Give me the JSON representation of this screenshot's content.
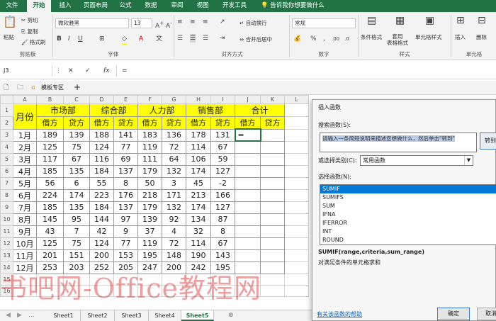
{
  "ribbon_tabs": [
    {
      "label": "文件",
      "active": false
    },
    {
      "label": "开始",
      "active": true
    },
    {
      "label": "插入",
      "active": false
    },
    {
      "label": "页面布局",
      "active": false
    },
    {
      "label": "公式",
      "active": false
    },
    {
      "label": "数据",
      "active": false
    },
    {
      "label": "审阅",
      "active": false
    },
    {
      "label": "视图",
      "active": false
    },
    {
      "label": "开发工具",
      "active": false
    }
  ],
  "tell_me": "告诉我你想要做什么",
  "ribbon": {
    "paste": "粘贴",
    "cut": "剪切",
    "copy": "复制",
    "format_painter": "格式刷",
    "font_name": "微软雅黑",
    "font_size": "13",
    "wrap_text": "自动换行",
    "merge_center": "合并后居中",
    "number_format": "常规",
    "conditional_format": "条件格式",
    "table_format": "套用\n表格格式",
    "cell_styles": "单元格样式",
    "insert": "插入",
    "delete": "删除",
    "groups": {
      "clipboard": "剪贴板",
      "font": "字体",
      "alignment": "对齐方式",
      "number": "数字",
      "styles": "样式",
      "cells": "单元格"
    }
  },
  "formula_bar": {
    "name_box": "J3",
    "content": "="
  },
  "quick_bar": {
    "template_tab": "模板专区",
    "add": "+"
  },
  "sheet": {
    "columns": [
      "A",
      "B",
      "C",
      "D",
      "E",
      "F",
      "G",
      "H",
      "I",
      "J",
      "K",
      "L"
    ],
    "row_numbers": [
      "1",
      "2",
      "3",
      "4",
      "5",
      "6",
      "7",
      "8",
      "9",
      "10",
      "11",
      "12",
      "13",
      "14",
      "15",
      "16"
    ],
    "month_header": "月份",
    "dept_headers": [
      "市场部",
      "综合部",
      "人力部",
      "销售部",
      "合计"
    ],
    "sub_headers": [
      "借方",
      "贷方",
      "借方",
      "贷方",
      "借方",
      "贷方",
      "借方",
      "贷方",
      "借方",
      "贷方"
    ],
    "rows": [
      {
        "month": "1月",
        "values": [
          "189",
          "139",
          "188",
          "141",
          "183",
          "136",
          "178",
          "131"
        ]
      },
      {
        "month": "2月",
        "values": [
          "125",
          "75",
          "124",
          "77",
          "119",
          "72",
          "114",
          "67"
        ]
      },
      {
        "month": "3月",
        "values": [
          "117",
          "67",
          "116",
          "69",
          "111",
          "64",
          "106",
          "59"
        ]
      },
      {
        "month": "4月",
        "values": [
          "185",
          "135",
          "184",
          "137",
          "179",
          "132",
          "174",
          "127"
        ]
      },
      {
        "month": "5月",
        "values": [
          "56",
          "6",
          "55",
          "8",
          "50",
          "3",
          "45",
          "-2"
        ]
      },
      {
        "month": "6月",
        "values": [
          "224",
          "174",
          "223",
          "176",
          "218",
          "171",
          "213",
          "166"
        ]
      },
      {
        "month": "7月",
        "values": [
          "185",
          "135",
          "184",
          "137",
          "179",
          "132",
          "174",
          "127"
        ]
      },
      {
        "month": "8月",
        "values": [
          "145",
          "95",
          "144",
          "97",
          "139",
          "92",
          "134",
          "87"
        ]
      },
      {
        "month": "9月",
        "values": [
          "43",
          "7",
          "42",
          "9",
          "37",
          "4",
          "32",
          "8"
        ]
      },
      {
        "month": "10月",
        "values": [
          "125",
          "75",
          "124",
          "77",
          "119",
          "72",
          "114",
          "67"
        ]
      },
      {
        "month": "11月",
        "values": [
          "201",
          "151",
          "200",
          "153",
          "195",
          "148",
          "190",
          "143"
        ]
      },
      {
        "month": "12月",
        "values": [
          "253",
          "203",
          "252",
          "205",
          "247",
          "200",
          "242",
          "195"
        ]
      }
    ],
    "active_cell_value": "="
  },
  "sheet_tabs": [
    {
      "label": "Sheet1",
      "active": false
    },
    {
      "label": "Sheet2",
      "active": false
    },
    {
      "label": "Sheet3",
      "active": false
    },
    {
      "label": "Sheet4",
      "active": false
    },
    {
      "label": "Sheet5",
      "active": true
    }
  ],
  "watermark": "书吧网-Office教程网",
  "dialog": {
    "title": "插入函数",
    "search_label": "搜索函数(S):",
    "search_placeholder": "请输入一条简短说明来描述您想做什么，然后单击\"转到\"",
    "go_button": "转到",
    "category_label": "或选择类别(C):",
    "category_value": "常用函数",
    "select_label": "选择函数(N):",
    "functions": [
      "SUMIF",
      "SUMIFS",
      "SUM",
      "IFNA",
      "IFERROR",
      "INT",
      "ROUND"
    ],
    "selected_function": "SUMIF",
    "signature": "SUMIF(range,criteria,sum_range)",
    "description": "对满足条件的单元格求和",
    "help_link": "有关该函数的帮助",
    "ok": "确定",
    "cancel": "取消"
  },
  "colors": {
    "excel_green": "#217346",
    "header_yellow": "#ffff00",
    "selection_blue": "#0078d7"
  }
}
